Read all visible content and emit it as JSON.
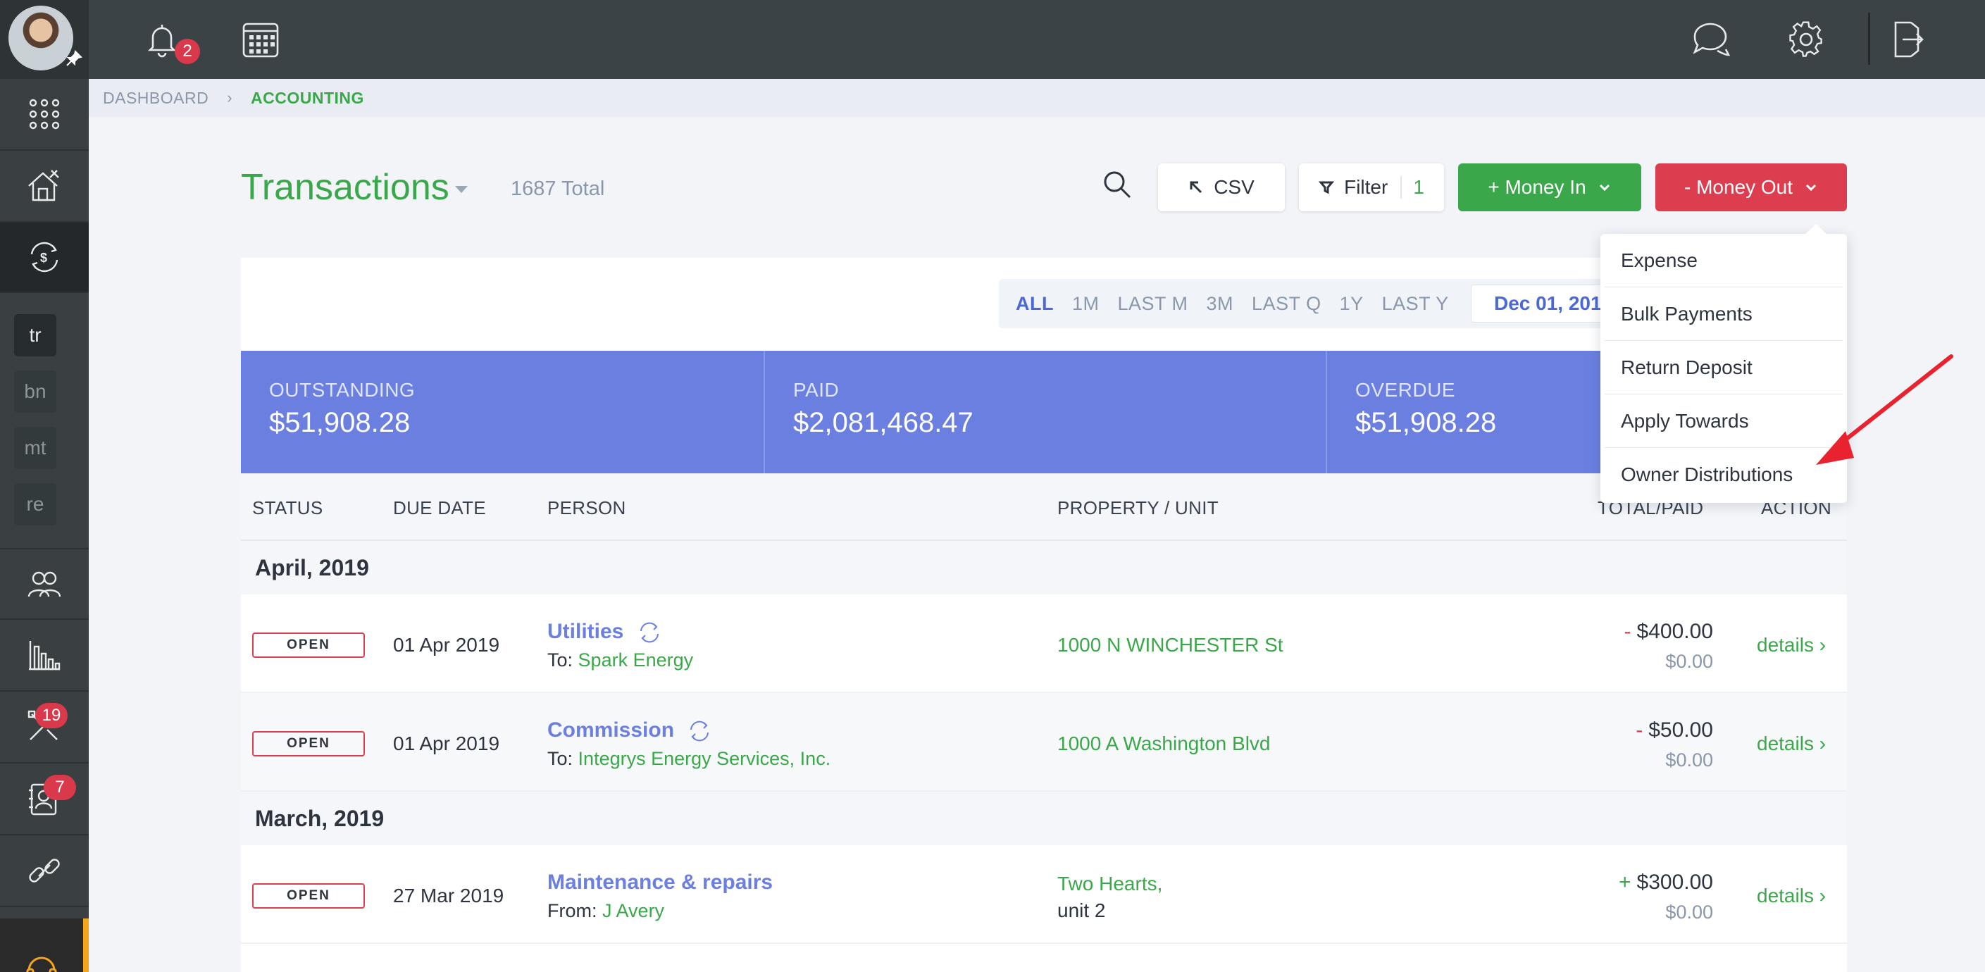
{
  "topbar": {
    "notification_count": "2",
    "icons": [
      "bell-icon",
      "calendar-icon",
      "chat-icon",
      "gear-icon",
      "logout-icon"
    ]
  },
  "sidebar": {
    "items": [
      {
        "icon": "apps-grid-icon"
      },
      {
        "icon": "house-tools-icon"
      },
      {
        "icon": "accounting-icon",
        "active": true
      },
      {
        "short": "tr"
      },
      {
        "short": "bn"
      },
      {
        "short": "mt"
      },
      {
        "short": "re"
      },
      {
        "icon": "people-icon"
      },
      {
        "icon": "reports-icon"
      },
      {
        "icon": "tools-icon",
        "badge": "19"
      },
      {
        "icon": "contact-card-icon",
        "badge": "7"
      },
      {
        "icon": "link-icon"
      },
      {
        "icon": "headset-icon"
      }
    ],
    "maintenance_badge": "19",
    "contacts_badge": "7"
  },
  "breadcrumb": {
    "home": "DASHBOARD",
    "current": "ACCOUNTING"
  },
  "header": {
    "title": "Transactions",
    "total": "1687 Total",
    "csv_label": "CSV",
    "filter_label": "Filter",
    "filter_count": "1",
    "money_in_label": "+ Money In",
    "money_out_label": "- Money Out"
  },
  "money_out_menu": {
    "items": [
      "Expense",
      "Bulk Payments",
      "Return Deposit",
      "Apply Towards",
      "Owner Distributions"
    ]
  },
  "periods": {
    "items": [
      "ALL",
      "1M",
      "LAST M",
      "3M",
      "LAST Q",
      "1Y",
      "LAST Y"
    ],
    "active": "ALL",
    "date_from": "Dec 01, 201"
  },
  "summary": {
    "outstanding_label": "OUTSTANDING",
    "outstanding_value": "$51,908.28",
    "paid_label": "PAID",
    "paid_value": "$2,081,468.47",
    "overdue_label": "OVERDUE",
    "overdue_value": "$51,908.28"
  },
  "table": {
    "columns": {
      "status": "STATUS",
      "due_date": "DUE DATE",
      "person": "PERSON",
      "property": "PROPERTY / UNIT",
      "total_paid": "TOTAL/PAID",
      "action": "ACTION"
    },
    "groups": [
      {
        "label": "April, 2019",
        "rows": [
          {
            "status": "OPEN",
            "due": "01 Apr 2019",
            "title": "Utilities",
            "recurring": true,
            "dir": "To:",
            "who": "Spark Energy",
            "property": "1000 N WINCHESTER St",
            "unit": "",
            "sign": "-",
            "total": "$400.00",
            "paid": "$0.00",
            "action": "details ›"
          },
          {
            "status": "OPEN",
            "due": "01 Apr 2019",
            "title": "Commission",
            "recurring": true,
            "dir": "To:",
            "who": "Integrys Energy Services, Inc.",
            "property": "1000 A Washington Blvd",
            "unit": "",
            "sign": "-",
            "total": "$50.00",
            "paid": "$0.00",
            "action": "details ›"
          }
        ]
      },
      {
        "label": "March, 2019",
        "rows": [
          {
            "status": "OPEN",
            "due": "27 Mar 2019",
            "title": "Maintenance & repairs",
            "recurring": false,
            "dir": "From:",
            "who": "J Avery",
            "property": "Two Hearts,",
            "unit": "unit 2",
            "sign": "+",
            "total": "$300.00",
            "paid": "$0.00",
            "action": "details ›"
          }
        ]
      }
    ]
  },
  "colors": {
    "brand_green": "#3aa84a",
    "danger_red": "#dc3d4f",
    "summary_blue": "#6b7fe0",
    "sidebar": "#3a3f42"
  }
}
